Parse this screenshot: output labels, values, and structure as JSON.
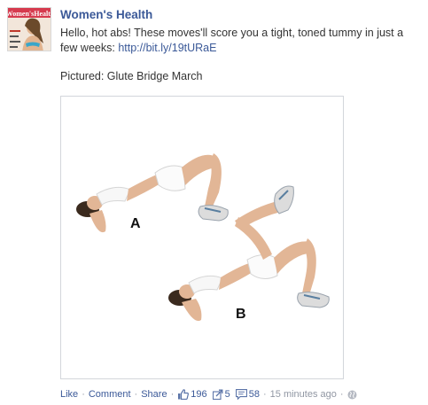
{
  "post": {
    "page_name": "Women's Health",
    "text": "Hello, hot abs! These moves'll score you a tight, toned tummy in just a few weeks: ",
    "link": "http://bit.ly/19tURaE",
    "caption": "Pictured: Glute Bridge March",
    "photo_labels": {
      "a": "A",
      "b": "B"
    },
    "avatar_masthead": "Women'sHealth"
  },
  "actions": {
    "like": "Like",
    "comment": "Comment",
    "share": "Share",
    "likes_count": "196",
    "shares_count": "5",
    "comments_count": "58",
    "timestamp": "15 minutes ago",
    "separator": "·",
    "privacy_icon": "globe-icon"
  },
  "colors": {
    "brand_blue": "#3b5998",
    "meta_gray": "#9197a3",
    "text": "#333333"
  }
}
